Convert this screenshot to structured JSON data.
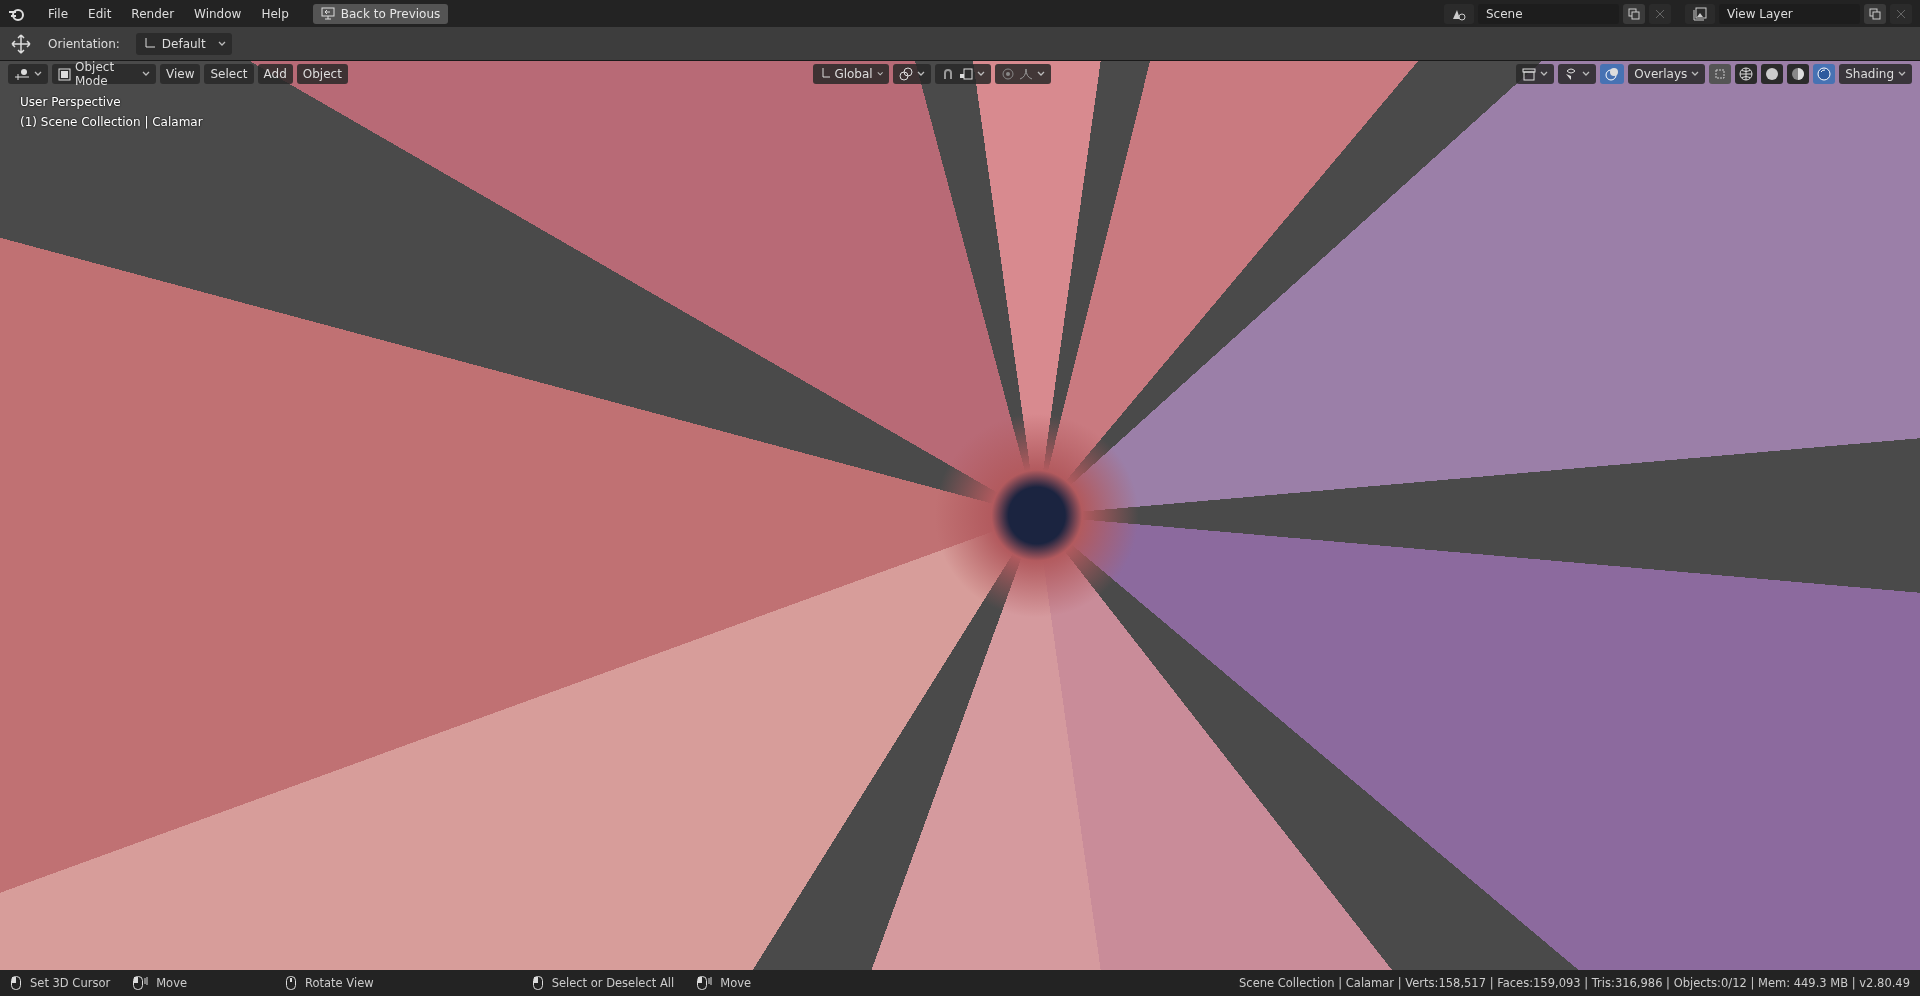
{
  "menu_bar": {
    "menus": [
      "File",
      "Edit",
      "Render",
      "Window",
      "Help"
    ],
    "back_button": "Back to Previous",
    "scene": {
      "value": "Scene"
    },
    "view_layer": {
      "value": "View Layer"
    }
  },
  "tool_settings": {
    "orientation_label": "Orientation:",
    "orientation_value": "Default"
  },
  "viewport": {
    "header": {
      "mode": "Object Mode",
      "menus": [
        "View",
        "Select",
        "Add",
        "Object"
      ],
      "transform_orientation": "Global",
      "overlays": {
        "label": "Overlays",
        "on": true
      },
      "shading_label": "Shading",
      "shading_modes": [
        {
          "kind": "wireframe",
          "selected": false
        },
        {
          "kind": "solid",
          "selected": false
        },
        {
          "kind": "material",
          "selected": false
        },
        {
          "kind": "rendered",
          "selected": true
        }
      ]
    },
    "info": [
      "User Perspective",
      "(1) Scene Collection | Calamar"
    ]
  },
  "status_bar": {
    "hints": [
      {
        "kind": "left",
        "label": "Set 3D Cursor"
      },
      {
        "kind": "drag",
        "label": "Move"
      },
      {
        "kind": "middle",
        "label": "Rotate View"
      },
      {
        "kind": "left",
        "label": "Select or Deselect All"
      },
      {
        "kind": "drag",
        "label": "Move"
      }
    ],
    "stats": "Scene Collection | Calamar | Verts:158,517 | Faces:159,093 | Tris:316,986 | Objects:0/12 | Mem: 449.3 MB | v2.80.49"
  }
}
